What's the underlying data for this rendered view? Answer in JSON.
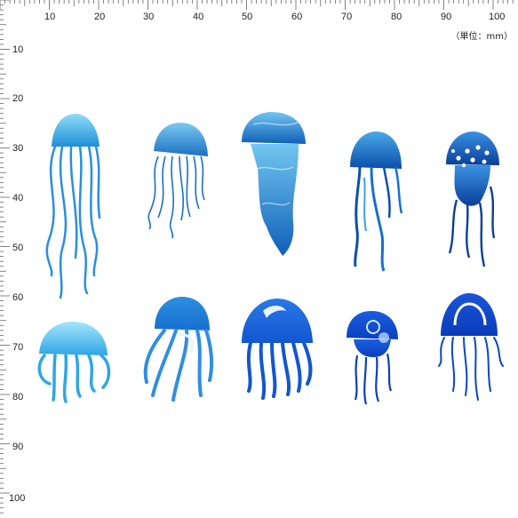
{
  "ruler": {
    "top_labels": [
      "10",
      "20",
      "30",
      "40",
      "50",
      "60",
      "70",
      "80",
      "90",
      "100"
    ],
    "left_labels": [
      "10",
      "20",
      "30",
      "40",
      "50",
      "60",
      "70",
      "80",
      "90",
      "100"
    ],
    "unit": "（単位：mm）"
  },
  "jellyfish": [
    {
      "id": "jellyfish-1",
      "style": "long-tentacles",
      "colors": [
        "#7fd3f5",
        "#1f8fd8"
      ]
    },
    {
      "id": "jellyfish-2",
      "style": "curly-tentacles",
      "colors": [
        "#6cc4ee",
        "#1c6fc4"
      ]
    },
    {
      "id": "jellyfish-3",
      "style": "long-body",
      "colors": [
        "#5bb9ec",
        "#0f5fb8"
      ]
    },
    {
      "id": "jellyfish-4",
      "style": "thin-tentacles",
      "colors": [
        "#3aa0e8",
        "#0b4fa8"
      ]
    },
    {
      "id": "jellyfish-5",
      "style": "spotted",
      "colors": [
        "#2f88de",
        "#0a3f9a"
      ]
    },
    {
      "id": "jellyfish-6",
      "style": "wide-bell",
      "colors": [
        "#9be2f8",
        "#2ea6e6"
      ]
    },
    {
      "id": "jellyfish-7",
      "style": "swirl",
      "colors": [
        "#2f8ee0",
        "#e8f4ff"
      ]
    },
    {
      "id": "jellyfish-8",
      "style": "round-bell",
      "colors": [
        "#1c6fe0",
        "#e6f2ff"
      ]
    },
    {
      "id": "jellyfish-9",
      "style": "small-dome",
      "colors": [
        "#0c4fd0",
        "#cfe6ff"
      ]
    },
    {
      "id": "jellyfish-10",
      "style": "outline",
      "colors": [
        "#0a46c8",
        "#ffffff"
      ]
    }
  ]
}
